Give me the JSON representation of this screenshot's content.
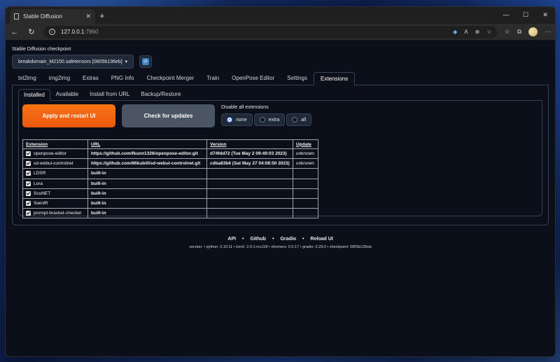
{
  "browser": {
    "tab_title": "Stable Diffusion",
    "tab_close": "✕",
    "new_tab": "+",
    "minimize": "—",
    "maximize": "☐",
    "close": "✕",
    "url_host": "127.0.0.1",
    "url_port": ":7860"
  },
  "checkpoint": {
    "label": "Stable Diffusion checkpoint",
    "value": "breakdomain_M2150.safetensors [0805b136eb]",
    "refresh_glyph": "⟳"
  },
  "main_tabs": [
    "txt2img",
    "img2img",
    "Extras",
    "PNG Info",
    "Checkpoint Merger",
    "Train",
    "OpenPose Editor",
    "Settings",
    "Extensions"
  ],
  "sub_tabs": [
    "Installed",
    "Available",
    "Install from URL",
    "Backup/Restore"
  ],
  "actions": {
    "apply": "Apply and restart UI",
    "check": "Check for updates",
    "disable_label": "Disable all extensions",
    "radio_options": [
      "none",
      "extra",
      "all"
    ],
    "radio_selected": "none",
    "apply_color": "#f97316"
  },
  "table": {
    "headers": [
      "Extension",
      "URL",
      "Version",
      "Update"
    ],
    "rows": [
      {
        "name": "openpose-editor",
        "url": "https://github.com/fkunn1326/openpose-editor.git",
        "version": "d74fdd72 (Tue May 2 09:49:03 2023)",
        "update": "unknown"
      },
      {
        "name": "sd-webui-controlnet",
        "url": "https://github.com/Mikubill/sd-webui-controlnet.git",
        "version": "cdba83b6 (Sat May 27 04:08:50 2023)",
        "update": "unknown"
      },
      {
        "name": "LDSR",
        "url": "built-in",
        "version": "",
        "update": ""
      },
      {
        "name": "Lora",
        "url": "built-in",
        "version": "",
        "update": ""
      },
      {
        "name": "ScuNET",
        "url": "built-in",
        "version": "",
        "update": ""
      },
      {
        "name": "SwinIR",
        "url": "built-in",
        "version": "",
        "update": ""
      },
      {
        "name": "prompt-bracket-checker",
        "url": "built-in",
        "version": "",
        "update": ""
      }
    ]
  },
  "footer": {
    "links": [
      "API",
      "Github",
      "Gradio",
      "Reload UI"
    ],
    "separator": "•",
    "versions": "version:  •  python: 3.10.11  •  torch: 2.0.1+cu118  •  xformers: 0.0.17  •  gradio: 3.29.0  •  checkpoint: 0805b136eb"
  }
}
